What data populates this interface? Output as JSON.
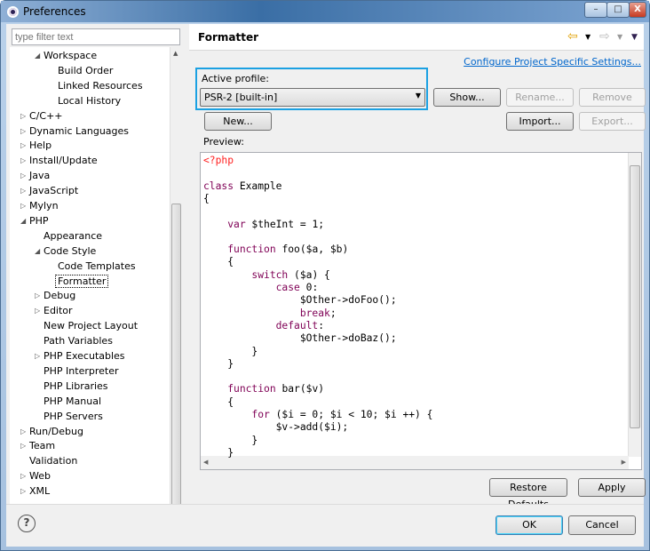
{
  "window": {
    "title": "Preferences",
    "minimize": "–",
    "maximize": "□",
    "close": "X"
  },
  "filter": {
    "placeholder": "type filter text"
  },
  "tree": [
    {
      "label": "Workspace",
      "level": 2,
      "twisty": "expanded"
    },
    {
      "label": "Build Order",
      "level": 3,
      "twisty": ""
    },
    {
      "label": "Linked Resources",
      "level": 3,
      "twisty": ""
    },
    {
      "label": "Local History",
      "level": 3,
      "twisty": ""
    },
    {
      "label": "C/C++",
      "level": 1,
      "twisty": "collapsed"
    },
    {
      "label": "Dynamic Languages",
      "level": 1,
      "twisty": "collapsed"
    },
    {
      "label": "Help",
      "level": 1,
      "twisty": "collapsed"
    },
    {
      "label": "Install/Update",
      "level": 1,
      "twisty": "collapsed"
    },
    {
      "label": "Java",
      "level": 1,
      "twisty": "collapsed"
    },
    {
      "label": "JavaScript",
      "level": 1,
      "twisty": "collapsed"
    },
    {
      "label": "Mylyn",
      "level": 1,
      "twisty": "collapsed"
    },
    {
      "label": "PHP",
      "level": 1,
      "twisty": "expanded"
    },
    {
      "label": "Appearance",
      "level": 2,
      "twisty": ""
    },
    {
      "label": "Code Style",
      "level": 2,
      "twisty": "expanded"
    },
    {
      "label": "Code Templates",
      "level": 3,
      "twisty": ""
    },
    {
      "label": "Formatter",
      "level": 3,
      "twisty": "",
      "selected": true
    },
    {
      "label": "Debug",
      "level": 2,
      "twisty": "collapsed"
    },
    {
      "label": "Editor",
      "level": 2,
      "twisty": "collapsed"
    },
    {
      "label": "New Project Layout",
      "level": 2,
      "twisty": ""
    },
    {
      "label": "Path Variables",
      "level": 2,
      "twisty": ""
    },
    {
      "label": "PHP Executables",
      "level": 2,
      "twisty": "collapsed"
    },
    {
      "label": "PHP Interpreter",
      "level": 2,
      "twisty": ""
    },
    {
      "label": "PHP Libraries",
      "level": 2,
      "twisty": ""
    },
    {
      "label": "PHP Manual",
      "level": 2,
      "twisty": ""
    },
    {
      "label": "PHP Servers",
      "level": 2,
      "twisty": ""
    },
    {
      "label": "Run/Debug",
      "level": 1,
      "twisty": "collapsed"
    },
    {
      "label": "Team",
      "level": 1,
      "twisty": "collapsed"
    },
    {
      "label": "Validation",
      "level": 1,
      "twisty": ""
    },
    {
      "label": "Web",
      "level": 1,
      "twisty": "collapsed"
    },
    {
      "label": "XML",
      "level": 1,
      "twisty": "collapsed"
    }
  ],
  "page": {
    "title": "Formatter",
    "configure_link": "Configure Project Specific Settings...",
    "active_profile_label": "Active profile:",
    "profile_value": "PSR-2 [built-in]",
    "buttons": {
      "show": "Show...",
      "rename": "Rename...",
      "remove": "Remove",
      "new": "New...",
      "import": "Import...",
      "export": "Export..."
    },
    "preview_label": "Preview:",
    "code": [
      [
        {
          "t": "<?php",
          "c": "php"
        }
      ],
      [],
      [
        {
          "t": "class",
          "c": "kw"
        },
        {
          "t": " Example"
        }
      ],
      [
        {
          "t": "{"
        }
      ],
      [],
      [
        {
          "t": "    "
        },
        {
          "t": "var",
          "c": "kw"
        },
        {
          "t": " $theInt = 1;"
        }
      ],
      [],
      [
        {
          "t": "    "
        },
        {
          "t": "function",
          "c": "kw"
        },
        {
          "t": " foo($a, $b)"
        }
      ],
      [
        {
          "t": "    {"
        }
      ],
      [
        {
          "t": "        "
        },
        {
          "t": "switch",
          "c": "kw"
        },
        {
          "t": " ($a) {"
        }
      ],
      [
        {
          "t": "            "
        },
        {
          "t": "case",
          "c": "kw"
        },
        {
          "t": " 0:"
        }
      ],
      [
        {
          "t": "                $Other->doFoo();"
        }
      ],
      [
        {
          "t": "                "
        },
        {
          "t": "break",
          "c": "kw"
        },
        {
          "t": ";"
        }
      ],
      [
        {
          "t": "            "
        },
        {
          "t": "default",
          "c": "kw"
        },
        {
          "t": ":"
        }
      ],
      [
        {
          "t": "                $Other->doBaz();"
        }
      ],
      [
        {
          "t": "        }"
        }
      ],
      [
        {
          "t": "    }"
        }
      ],
      [],
      [
        {
          "t": "    "
        },
        {
          "t": "function",
          "c": "kw"
        },
        {
          "t": " bar($v)"
        }
      ],
      [
        {
          "t": "    {"
        }
      ],
      [
        {
          "t": "        "
        },
        {
          "t": "for",
          "c": "kw"
        },
        {
          "t": " ($i = 0; $i < 10; $i ++) {"
        }
      ],
      [
        {
          "t": "            $v->add($i);"
        }
      ],
      [
        {
          "t": "        }"
        }
      ],
      [
        {
          "t": "    }"
        }
      ]
    ],
    "restore_defaults": "Restore Defaults",
    "apply": "Apply"
  },
  "footer": {
    "help": "?",
    "ok": "OK",
    "cancel": "Cancel"
  },
  "colors": {
    "keyword": "#7f0055",
    "php_tag": "#ff2020",
    "highlight": "#1ba1e2",
    "link": "#0066cc"
  }
}
